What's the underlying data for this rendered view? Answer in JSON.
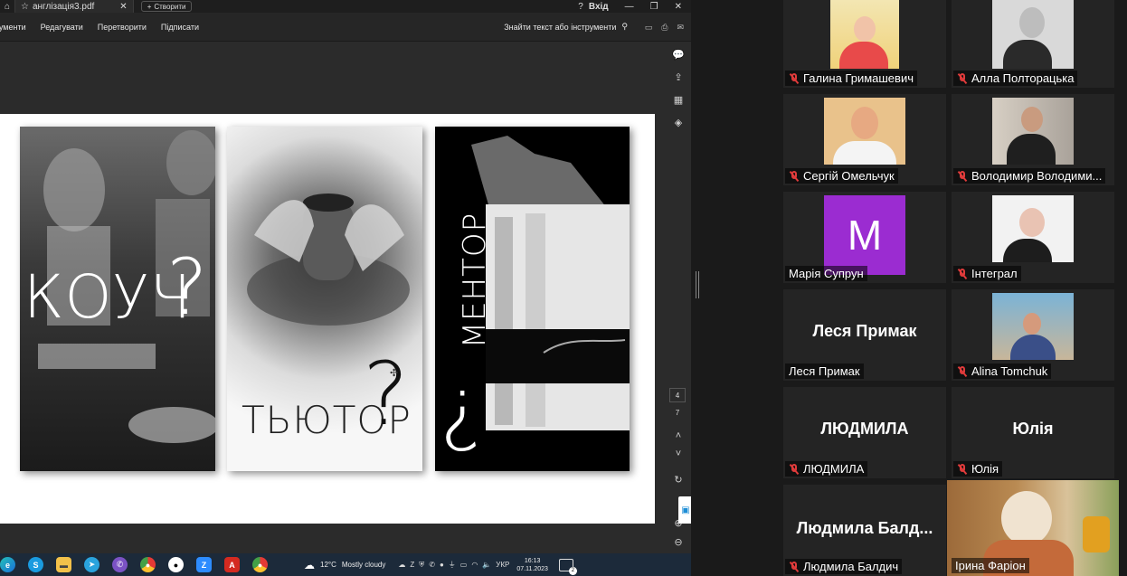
{
  "viewer": {
    "tab_file": "англізація3.pdf",
    "new_tab_label": "Створити",
    "sign_in": "Вхід",
    "menu": [
      "рументи",
      "Редагувати",
      "Перетворити",
      "Підписати"
    ],
    "find_label": "Знайти текст або інструменти",
    "page_current": "4",
    "page_total": "7",
    "panels": {
      "coach": "КОУЧ",
      "tutor": "ТЬЮТОР",
      "mentor": "МЕНТОР"
    }
  },
  "taskbar": {
    "weather_temp": "12°C",
    "weather_desc": "Mostly cloudy",
    "language": "УКР",
    "time": "16:13",
    "date": "07.11.2023",
    "notifications": "2"
  },
  "gallery": {
    "participants": [
      {
        "name": "Галина Гримашевич",
        "muted": true,
        "type": "video"
      },
      {
        "name": "Алла Полторацька",
        "muted": true,
        "type": "video"
      },
      {
        "name": "Сергій Омельчук",
        "muted": true,
        "type": "video"
      },
      {
        "name": "Володимир Володими...",
        "muted": true,
        "type": "video"
      },
      {
        "name": "Марія Супрун",
        "muted": false,
        "type": "avatar",
        "initial": "M",
        "avatar_color": "#9b2cd1"
      },
      {
        "name": "Інтеграл",
        "muted": true,
        "type": "video"
      },
      {
        "name": "Леся Примак",
        "muted": false,
        "type": "text",
        "display": "Леся Примак"
      },
      {
        "name": "Alina Tomchuk",
        "muted": true,
        "type": "video"
      },
      {
        "name": "ЛЮДМИЛА",
        "muted": true,
        "type": "text",
        "display": "ЛЮДМИЛА"
      },
      {
        "name": "Юлія",
        "muted": true,
        "type": "text",
        "display": "Юлія"
      },
      {
        "name": "Людмила Балдич",
        "muted": true,
        "type": "text",
        "display": "Людмила  Балд..."
      },
      {
        "name": "Ірина Фаріон",
        "muted": false,
        "type": "video",
        "active_speaker": true
      }
    ]
  }
}
